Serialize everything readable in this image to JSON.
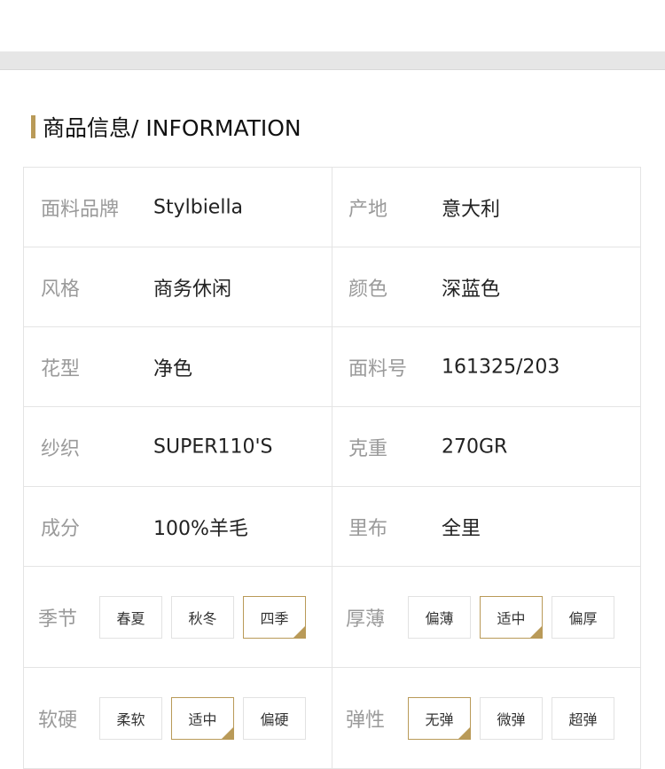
{
  "section": {
    "title": "商品信息/ INFORMATION",
    "accent_color": "#b99a58"
  },
  "info_rows": [
    {
      "left": {
        "label": "面料品牌",
        "value": "Stylbiella"
      },
      "right": {
        "label": "产地",
        "value": "意大利"
      }
    },
    {
      "left": {
        "label": "风格",
        "value": "商务休闲"
      },
      "right": {
        "label": "颜色",
        "value": "深蓝色"
      }
    },
    {
      "left": {
        "label": "花型",
        "value": "净色"
      },
      "right": {
        "label": "面料号",
        "value": "161325/203"
      }
    },
    {
      "left": {
        "label": "纱织",
        "value": "SUPER110'S"
      },
      "right": {
        "label": "克重",
        "value": "270GR"
      }
    },
    {
      "left": {
        "label": "成分",
        "value": "100%羊毛"
      },
      "right": {
        "label": "里布",
        "value": "全里"
      }
    }
  ],
  "option_rows": [
    {
      "left": {
        "label": "季节",
        "options": [
          "春夏",
          "秋冬",
          "四季"
        ],
        "selected": "四季"
      },
      "right": {
        "label": "厚薄",
        "options": [
          "偏薄",
          "适中",
          "偏厚"
        ],
        "selected": "适中"
      }
    },
    {
      "left": {
        "label": "软硬",
        "options": [
          "柔软",
          "适中",
          "偏硬"
        ],
        "selected": "适中"
      },
      "right": {
        "label": "弹性",
        "options": [
          "无弹",
          "微弹",
          "超弹"
        ],
        "selected": "无弹"
      }
    }
  ]
}
